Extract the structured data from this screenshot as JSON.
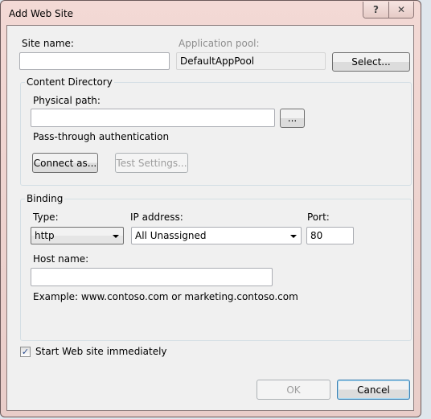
{
  "window": {
    "title": "Add Web Site",
    "help": "?",
    "close": "✕"
  },
  "site": {
    "name_label": "Site name:",
    "name_value": "",
    "pool_label": "Application pool:",
    "pool_value": "DefaultAppPool",
    "select_button": "Select..."
  },
  "content": {
    "group_label": "Content Directory",
    "path_label": "Physical path:",
    "path_value": "",
    "browse_button": "...",
    "auth_text": "Pass-through authentication",
    "connect_button": "Connect as...",
    "test_button": "Test Settings..."
  },
  "binding": {
    "group_label": "Binding",
    "type_label": "Type:",
    "type_value": "http",
    "ip_label": "IP address:",
    "ip_value": "All Unassigned",
    "port_label": "Port:",
    "port_value": "80",
    "host_label": "Host name:",
    "host_value": "",
    "example": "Example: www.contoso.com or marketing.contoso.com"
  },
  "start": {
    "label": "Start Web site immediately",
    "checked": true,
    "check_glyph": "✓"
  },
  "footer": {
    "ok": "OK",
    "cancel": "Cancel"
  }
}
